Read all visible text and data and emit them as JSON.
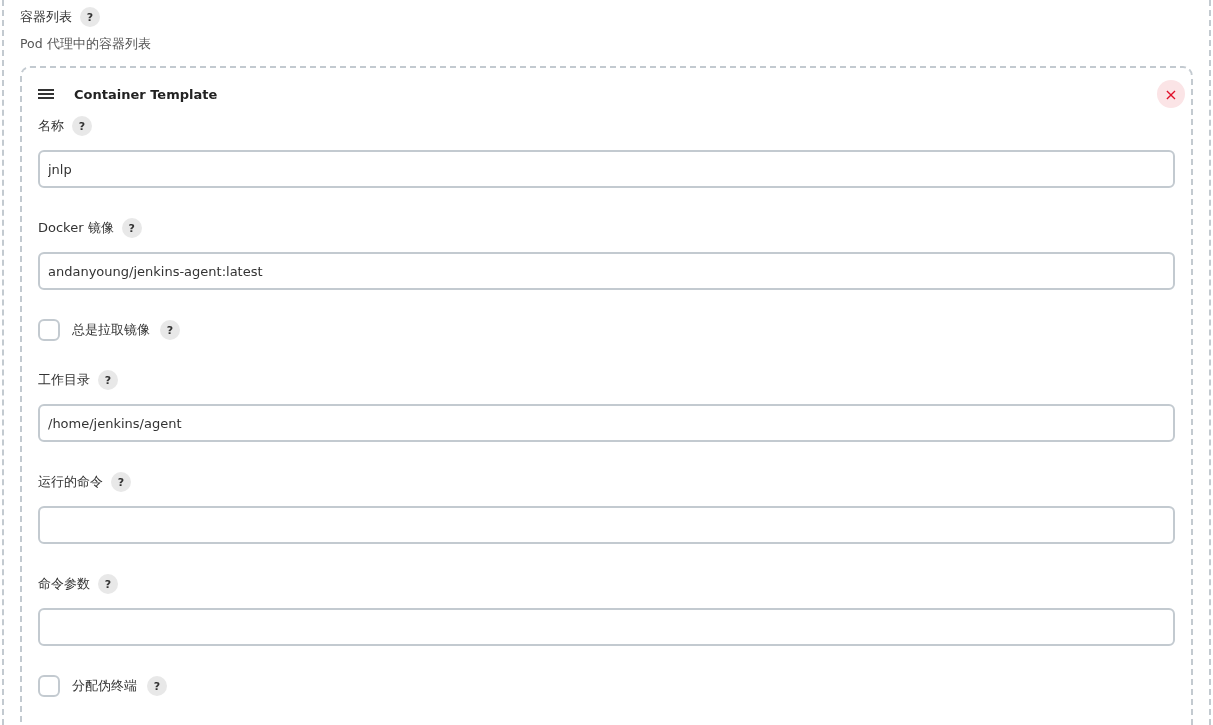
{
  "section": {
    "title": "容器列表",
    "help": "?",
    "description": "Pod 代理中的容器列表"
  },
  "template": {
    "title": "Container Template",
    "close": "×",
    "fields": [
      {
        "kind": "text",
        "label": "名称",
        "help": "?",
        "value": "jnlp"
      },
      {
        "kind": "text",
        "label": "Docker 镜像",
        "help": "?",
        "value": "andanyoung/jenkins-agent:latest"
      },
      {
        "kind": "checkbox",
        "label": "总是拉取镜像",
        "help": "?",
        "checked": false
      },
      {
        "kind": "text",
        "label": "工作目录",
        "help": "?",
        "value": "/home/jenkins/agent"
      },
      {
        "kind": "text",
        "label": "运行的命令",
        "help": "?"
      },
      {
        "kind": "text",
        "label": "命令参数",
        "help": "?"
      },
      {
        "kind": "checkbox",
        "label": "分配伪终端",
        "help": "?",
        "checked": false
      }
    ]
  }
}
